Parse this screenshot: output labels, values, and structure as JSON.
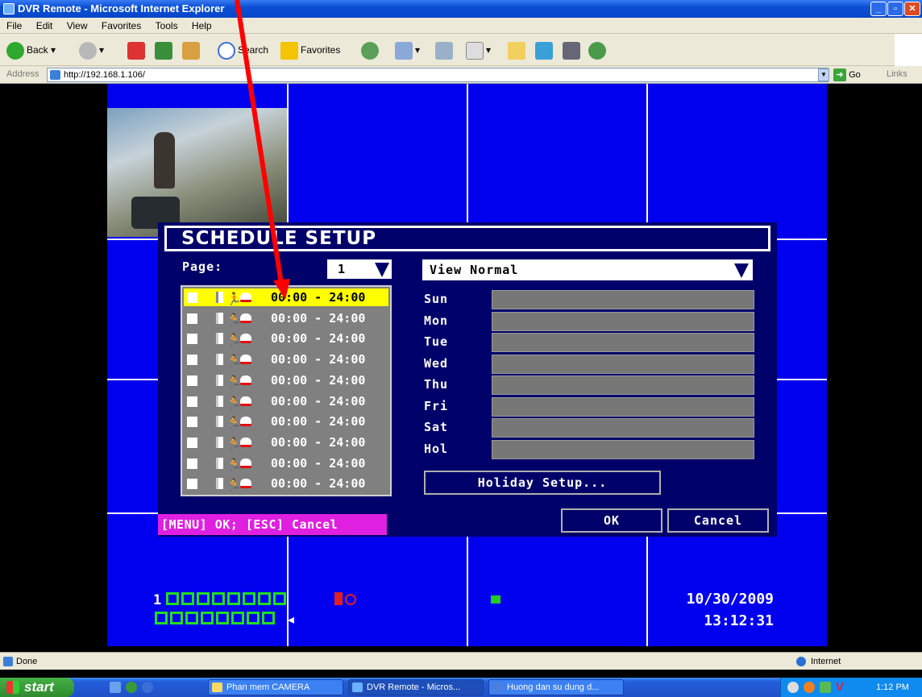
{
  "window": {
    "title": "DVR Remote - Microsoft Internet Explorer"
  },
  "menu": [
    "File",
    "Edit",
    "View",
    "Favorites",
    "Tools",
    "Help"
  ],
  "toolbar": {
    "back": "Back",
    "search": "Search",
    "favorites": "Favorites"
  },
  "address": {
    "label": "Address",
    "url": "http://192.168.1.106/",
    "go": "Go",
    "links": "Links"
  },
  "dialog": {
    "title": "SCHEDULE SETUP",
    "page_label": "Page:",
    "page_value": "1",
    "view_value": "View Normal",
    "schedules": [
      "00:00 - 24:00",
      "00:00 - 24:00",
      "00:00 - 24:00",
      "00:00 - 24:00",
      "00:00 - 24:00",
      "00:00 - 24:00",
      "00:00 - 24:00",
      "00:00 - 24:00",
      "00:00 - 24:00",
      "00:00 - 24:00"
    ],
    "days": [
      "Sun",
      "Mon",
      "Tue",
      "Wed",
      "Thu",
      "Fri",
      "Sat",
      "Hol"
    ],
    "holiday_button": "Holiday Setup...",
    "ok": "OK",
    "cancel": "Cancel",
    "hint": "[MENU] OK; [ESC] Cancel"
  },
  "osd": {
    "channel": "1",
    "date": "10/30/2009",
    "time": "13:12:31"
  },
  "status": {
    "left": "Done",
    "zone": "Internet"
  },
  "taskbar": {
    "start": "start",
    "tasks": [
      "Phan mem CAMERA",
      "DVR Remote - Micros...",
      "Huong dan su dung d..."
    ],
    "clock": "1:12 PM"
  }
}
